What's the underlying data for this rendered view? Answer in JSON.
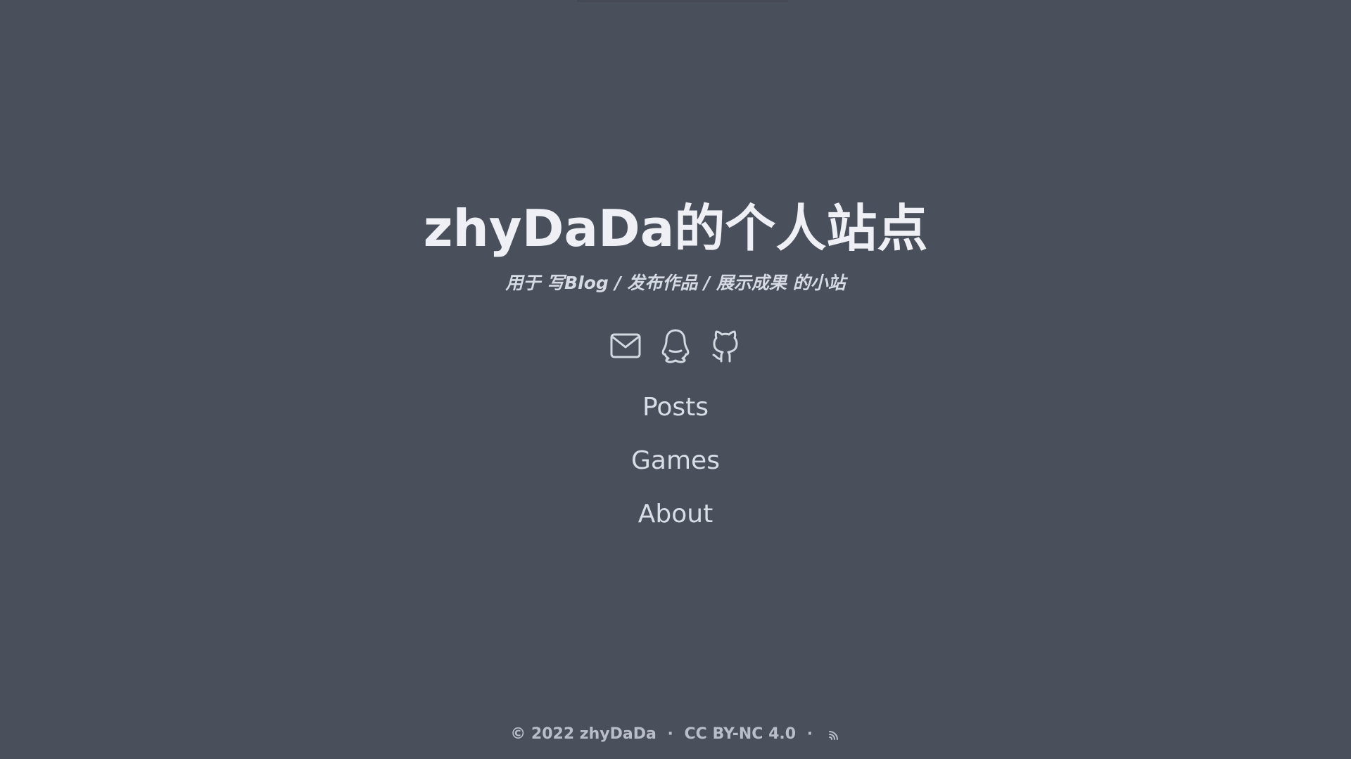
{
  "header": {
    "title": "zhyDaDa的个人站点",
    "subtitle": "用于 写Blog / 发布作品 / 展示成果 的小站"
  },
  "socials": [
    {
      "icon": "mail-icon"
    },
    {
      "icon": "qq-icon"
    },
    {
      "icon": "github-icon"
    }
  ],
  "nav": {
    "items": [
      {
        "label": "Posts"
      },
      {
        "label": "Games"
      },
      {
        "label": "About"
      }
    ]
  },
  "footer": {
    "copyright": "© 2022 zhyDaDa",
    "separator": "·",
    "license": "CC BY-NC 4.0",
    "rss_icon": "rss-icon"
  },
  "colors": {
    "background": "#4a4f5c",
    "title": "#eef0f5",
    "text": "#d9dde6",
    "footer": "#b9bec9"
  }
}
